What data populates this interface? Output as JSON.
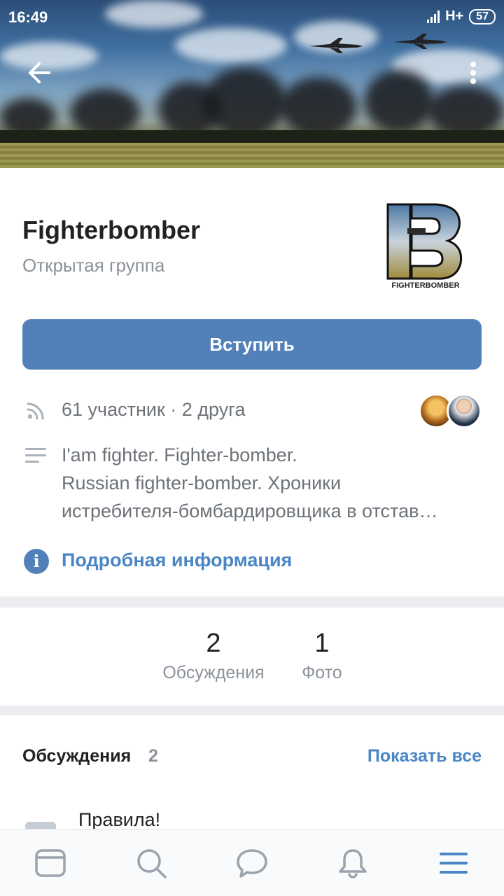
{
  "status_bar": {
    "time": "16:49",
    "network": "H+",
    "battery": "57"
  },
  "group": {
    "name": "Fighterbomber",
    "type": "Открытая группа",
    "logo_text": "FIGHTERBOMBER",
    "join_label": "Вступить",
    "members_text": "61 участник · 2 друга",
    "description_lines": [
      "I'am fighter. Fighter-bomber.",
      "Russian fighter-bomber. Хроники",
      "истребителя-бомбардировщика в отстав…"
    ],
    "more_info_label": "Подробная информация"
  },
  "counters": [
    {
      "value": "2",
      "label": "Обсуждения"
    },
    {
      "value": "1",
      "label": "Фото"
    }
  ],
  "discussions": {
    "title": "Обсуждения",
    "count": "2",
    "show_all": "Показать все",
    "topics": [
      {
        "title": "Правила!"
      }
    ]
  },
  "bottom_nav": {
    "items": [
      {
        "icon": "news-feed-icon",
        "active": false
      },
      {
        "icon": "search-icon",
        "active": false
      },
      {
        "icon": "messages-icon",
        "active": false
      },
      {
        "icon": "notifications-icon",
        "active": false
      },
      {
        "icon": "menu-icon",
        "active": true
      }
    ]
  },
  "colors": {
    "accent": "#5181b8",
    "link": "#4a86c5",
    "secondary_text": "#8c929a",
    "nav_inactive": "#9aa3ae"
  }
}
